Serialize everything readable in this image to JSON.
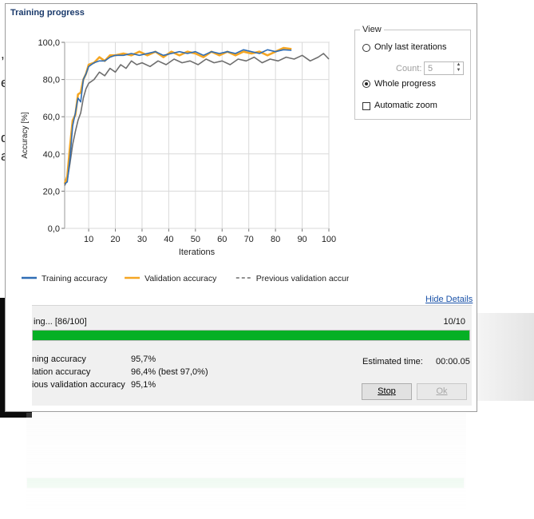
{
  "background_fragments": [
    ",",
    "er,",
    "d",
    "a"
  ],
  "window": {
    "title": "Training progress"
  },
  "view": {
    "legend": "View",
    "only_last_label": "Only last iterations",
    "count_label": "Count:",
    "count_value": "5",
    "whole_progress_label": "Whole progress",
    "auto_zoom_label": "Automatic zoom",
    "selected": "whole_progress",
    "automatic_zoom_checked": false
  },
  "chart_data": {
    "type": "line",
    "xlabel": "Iterations",
    "ylabel": "Accuracy [%]",
    "xlim": [
      1,
      100
    ],
    "ylim": [
      0,
      100
    ],
    "x_ticks": [
      "10",
      "20",
      "30",
      "40",
      "50",
      "60",
      "70",
      "80",
      "90",
      "100"
    ],
    "y_ticks": [
      "0,0",
      "20,0",
      "40,0",
      "60,0",
      "80,0",
      "100,0"
    ],
    "grid": true,
    "legend_position": "bottom",
    "series": [
      {
        "name": "Training accuracy",
        "color": "#2f6db5",
        "style": "solid",
        "points": [
          [
            1,
            24
          ],
          [
            2,
            25
          ],
          [
            3,
            38
          ],
          [
            4,
            55
          ],
          [
            5,
            62
          ],
          [
            6,
            70
          ],
          [
            7,
            68
          ],
          [
            8,
            80
          ],
          [
            9,
            83
          ],
          [
            10,
            87
          ],
          [
            12,
            89
          ],
          [
            14,
            90
          ],
          [
            16,
            90
          ],
          [
            18,
            92
          ],
          [
            20,
            93
          ],
          [
            23,
            93
          ],
          [
            26,
            94
          ],
          [
            29,
            93
          ],
          [
            32,
            94
          ],
          [
            35,
            95
          ],
          [
            38,
            93
          ],
          [
            41,
            94
          ],
          [
            44,
            95
          ],
          [
            47,
            94
          ],
          [
            50,
            95
          ],
          [
            53,
            93
          ],
          [
            56,
            95
          ],
          [
            59,
            94
          ],
          [
            62,
            95
          ],
          [
            65,
            94
          ],
          [
            68,
            96
          ],
          [
            71,
            95
          ],
          [
            74,
            94
          ],
          [
            77,
            96
          ],
          [
            80,
            95
          ],
          [
            83,
            96
          ],
          [
            86,
            95.7
          ]
        ]
      },
      {
        "name": "Validation accuracy",
        "color": "#f5a623",
        "style": "solid",
        "points": [
          [
            1,
            24
          ],
          [
            2,
            28
          ],
          [
            3,
            44
          ],
          [
            4,
            58
          ],
          [
            5,
            61
          ],
          [
            6,
            72
          ],
          [
            7,
            73
          ],
          [
            8,
            80
          ],
          [
            9,
            83
          ],
          [
            10,
            88
          ],
          [
            12,
            89
          ],
          [
            14,
            92
          ],
          [
            16,
            90
          ],
          [
            18,
            93
          ],
          [
            20,
            93
          ],
          [
            23,
            94
          ],
          [
            26,
            93
          ],
          [
            29,
            95
          ],
          [
            32,
            93
          ],
          [
            35,
            95
          ],
          [
            38,
            92
          ],
          [
            41,
            95
          ],
          [
            44,
            93
          ],
          [
            47,
            95
          ],
          [
            50,
            94
          ],
          [
            53,
            92
          ],
          [
            56,
            95
          ],
          [
            59,
            93
          ],
          [
            62,
            95
          ],
          [
            65,
            93
          ],
          [
            68,
            95
          ],
          [
            71,
            94
          ],
          [
            74,
            95
          ],
          [
            77,
            93
          ],
          [
            80,
            95
          ],
          [
            83,
            97
          ],
          [
            86,
            96.4
          ]
        ]
      },
      {
        "name": "Previous validation accuracy",
        "color": "#6e6e6e",
        "style": "dashed",
        "points": [
          [
            1,
            23
          ],
          [
            2,
            26
          ],
          [
            3,
            35
          ],
          [
            4,
            45
          ],
          [
            5,
            52
          ],
          [
            6,
            58
          ],
          [
            7,
            62
          ],
          [
            8,
            70
          ],
          [
            9,
            75
          ],
          [
            10,
            78
          ],
          [
            12,
            80
          ],
          [
            14,
            84
          ],
          [
            16,
            82
          ],
          [
            18,
            86
          ],
          [
            20,
            84
          ],
          [
            22,
            88
          ],
          [
            24,
            86
          ],
          [
            26,
            90
          ],
          [
            28,
            88
          ],
          [
            30,
            89
          ],
          [
            33,
            87
          ],
          [
            36,
            90
          ],
          [
            39,
            88
          ],
          [
            42,
            91
          ],
          [
            45,
            89
          ],
          [
            48,
            90
          ],
          [
            51,
            88
          ],
          [
            54,
            91
          ],
          [
            57,
            89
          ],
          [
            60,
            90
          ],
          [
            63,
            88
          ],
          [
            66,
            91
          ],
          [
            69,
            90
          ],
          [
            72,
            92
          ],
          [
            75,
            89
          ],
          [
            78,
            91
          ],
          [
            81,
            90
          ],
          [
            84,
            92
          ],
          [
            87,
            91
          ],
          [
            90,
            93
          ],
          [
            93,
            90
          ],
          [
            96,
            92
          ],
          [
            98,
            94
          ],
          [
            100,
            91
          ]
        ]
      }
    ]
  },
  "details_link": "Hide Details",
  "progress": {
    "status_text": "ing... [86/100]",
    "count_text": "10/10",
    "fraction": 1.0,
    "bar_color": "#06b025"
  },
  "metrics": [
    {
      "label": "ning accuracy",
      "value": "95,7%"
    },
    {
      "label": "lation accuracy",
      "value": "96,4% (best 97,0%)"
    },
    {
      "label": "ious validation accuracy",
      "value": "95,1%"
    }
  ],
  "estimated": {
    "label": "Estimated time:",
    "value": "00:00.05"
  },
  "buttons": {
    "stop": "Stop",
    "ok": "Ok"
  }
}
